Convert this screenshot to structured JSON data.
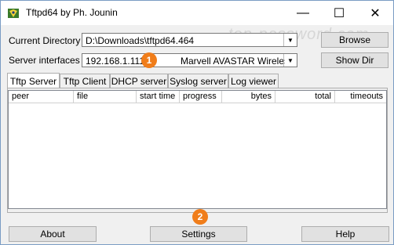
{
  "window": {
    "title": "Tftpd64 by Ph. Jounin",
    "minimize_glyph": "—",
    "maximize_glyph": "☐",
    "close_glyph": "✕",
    "watermark": "top-password.com"
  },
  "current_directory": {
    "label": "Current Directory",
    "value": "D:\\Downloads\\tftpd64.464",
    "browse_label": "Browse"
  },
  "server_interfaces": {
    "label": "Server interfaces",
    "ip": "192.168.1.111",
    "adapter": "Marvell AVASTAR Wireless",
    "show_dir_label": "Show Dir"
  },
  "badges": {
    "one": "1",
    "two": "2"
  },
  "tabs": [
    {
      "label": "Tftp Server",
      "active": true
    },
    {
      "label": "Tftp Client",
      "active": false
    },
    {
      "label": "DHCP server",
      "active": false
    },
    {
      "label": "Syslog server",
      "active": false
    },
    {
      "label": "Log viewer",
      "active": false
    }
  ],
  "columns": [
    "peer",
    "file",
    "start time",
    "progress",
    "bytes",
    "total",
    "timeouts"
  ],
  "footer": {
    "about_label": "About",
    "settings_label": "Settings",
    "help_label": "Help"
  },
  "colors": {
    "accent": "#f07d1a",
    "border": "#adadad"
  }
}
